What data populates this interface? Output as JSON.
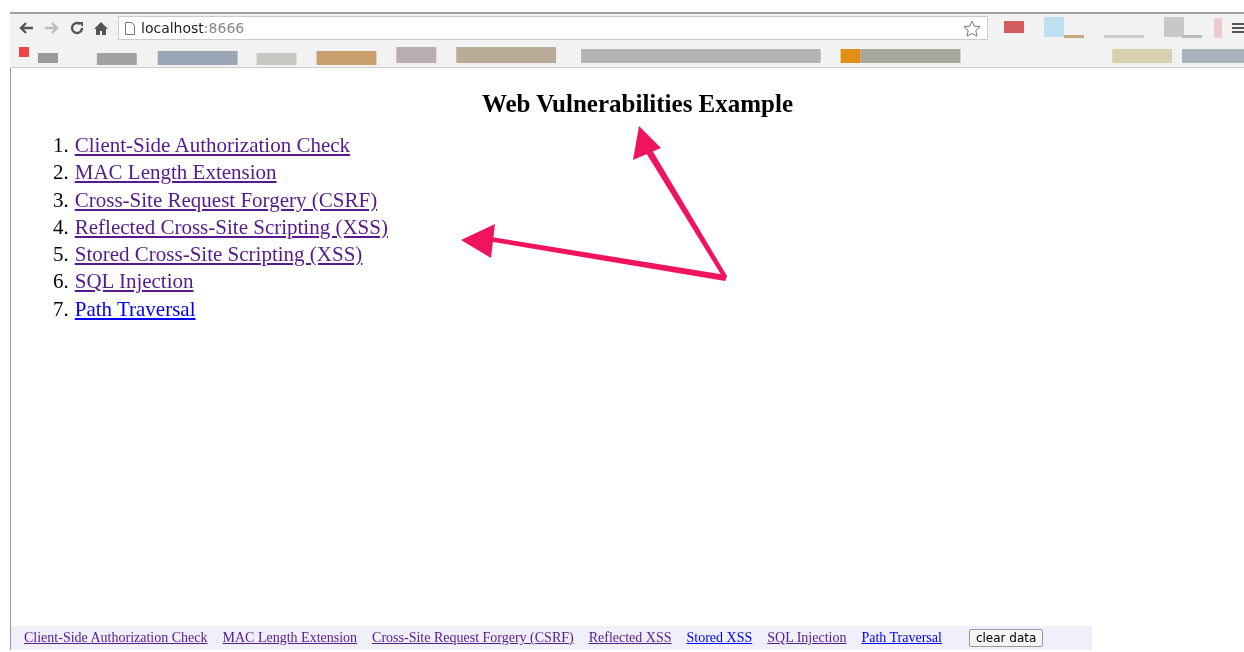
{
  "browser": {
    "url_host": "localhost",
    "url_port": ":8666"
  },
  "page": {
    "title": "Web Vulnerabilities Example",
    "links": [
      {
        "number": "1.",
        "label": "Client-Side Authorization Check",
        "visited": true
      },
      {
        "number": "2.",
        "label": "MAC Length Extension",
        "visited": true
      },
      {
        "number": "3.",
        "label": "Cross-Site Request Forgery (CSRF)",
        "visited": true
      },
      {
        "number": "4.",
        "label": "Reflected Cross-Site Scripting (XSS)",
        "visited": true
      },
      {
        "number": "5.",
        "label": "Stored Cross-Site Scripting (XSS)",
        "visited": true
      },
      {
        "number": "6.",
        "label": "SQL Injection",
        "visited": true
      },
      {
        "number": "7.",
        "label": "Path Traversal",
        "visited": false
      }
    ]
  },
  "footer": {
    "links": [
      {
        "label": "Client-Side Authorization Check",
        "visited": true
      },
      {
        "label": "MAC Length Extension",
        "visited": true
      },
      {
        "label": "Cross-Site Request Forgery (CSRF)",
        "visited": true
      },
      {
        "label": "Reflected XSS",
        "visited": true
      },
      {
        "label": "Stored XSS",
        "visited": false
      },
      {
        "label": "SQL Injection",
        "visited": true
      },
      {
        "label": "Path Traversal",
        "visited": false
      }
    ],
    "button": "clear data"
  }
}
